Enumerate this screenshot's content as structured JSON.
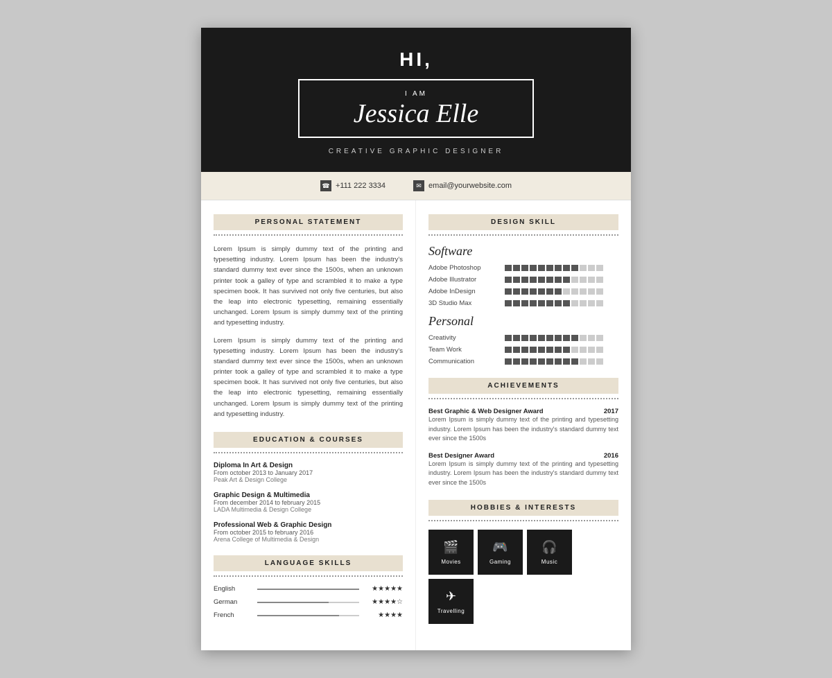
{
  "header": {
    "hi": "HI,",
    "i_am": "I AM",
    "name": "Jessica Elle",
    "subtitle": "CREATIVE GRAPHIC DESIGNER"
  },
  "contact": {
    "phone_icon": "☎",
    "phone": "+111 222 3334",
    "email_icon": "✉",
    "email": "email@yourwebsite.com"
  },
  "personal_statement": {
    "section_title": "PERSONAL STATEMENT",
    "paragraph1": "Lorem Ipsum is simply dummy text of the printing and typesetting industry. Lorem Ipsum has been the industry's standard dummy text ever since the 1500s, when an unknown printer took a galley of type and scrambled it to make a type specimen book. It has survived not only five centuries, but also the leap into electronic typesetting, remaining essentially unchanged. Lorem Ipsum is simply dummy text of the printing and typesetting industry.",
    "paragraph2": "Lorem Ipsum is simply dummy text of the printing and typesetting industry. Lorem Ipsum has been the industry's standard dummy text ever since the 1500s, when an unknown printer took a galley of type and scrambled it to make a type specimen book. It has survived not only five centuries, but also the leap into electronic typesetting, remaining essentially unchanged. Lorem Ipsum is simply dummy text of the printing and typesetting industry."
  },
  "education": {
    "section_title": "EDUCATION & COURSES",
    "items": [
      {
        "title": "Diploma In Art & Design",
        "date": "From october 2013 to January 2017",
        "school": "Peak Art & Design College"
      },
      {
        "title": "Graphic Design & Multimedia",
        "date": "From december 2014 to february 2015",
        "school": "LADA Multimedia & Design College"
      },
      {
        "title": "Professional Web & Graphic Design",
        "date": "From october 2015 to february 2016",
        "school": "Arena College of Multimedia & Design"
      }
    ]
  },
  "language_skills": {
    "section_title": "LANGUAGE SKILLS",
    "items": [
      {
        "name": "English",
        "fill": 100,
        "stars": "★★★★★",
        "stars_empty": ""
      },
      {
        "name": "German",
        "fill": 70,
        "stars": "★★★★☆",
        "stars_empty": ""
      },
      {
        "name": "French",
        "fill": 80,
        "stars": "★★★★",
        "stars_empty": ""
      }
    ]
  },
  "design_skills": {
    "section_title": "DESIGN SKILL",
    "software_label": "Software",
    "software": [
      {
        "name": "Adobe Photoshop",
        "filled": 9,
        "empty": 3
      },
      {
        "name": "Adobe Illustrator",
        "filled": 8,
        "empty": 4
      },
      {
        "name": "Adobe InDesign",
        "filled": 7,
        "empty": 5
      },
      {
        "name": "3D Studio Max",
        "filled": 8,
        "empty": 4
      }
    ],
    "personal_label": "Personal",
    "personal": [
      {
        "name": "Creativity",
        "filled": 9,
        "empty": 3
      },
      {
        "name": "Team Work",
        "filled": 8,
        "empty": 4
      },
      {
        "name": "Communication",
        "filled": 9,
        "empty": 3
      }
    ]
  },
  "achievements": {
    "section_title": "ACHIEVEMENTS",
    "items": [
      {
        "title": "Best Graphic & Web Designer Award",
        "year": "2017",
        "text": "Lorem Ipsum is simply dummy text of the printing and typesetting industry. Lorem Ipsum has been the industry's standard dummy text ever since the 1500s"
      },
      {
        "title": "Best Designer Award",
        "year": "2016",
        "text": "Lorem Ipsum is simply dummy text of the printing and typesetting industry. Lorem Ipsum has been the industry's standard dummy text ever since the 1500s"
      }
    ]
  },
  "hobbies": {
    "section_title": "HOBBIES & INTERESTS",
    "items": [
      {
        "icon": "🎬",
        "label": "Movies"
      },
      {
        "icon": "🎮",
        "label": "Gaming"
      },
      {
        "icon": "🎧",
        "label": "Music"
      },
      {
        "icon": "✈",
        "label": "Travelling"
      }
    ]
  }
}
